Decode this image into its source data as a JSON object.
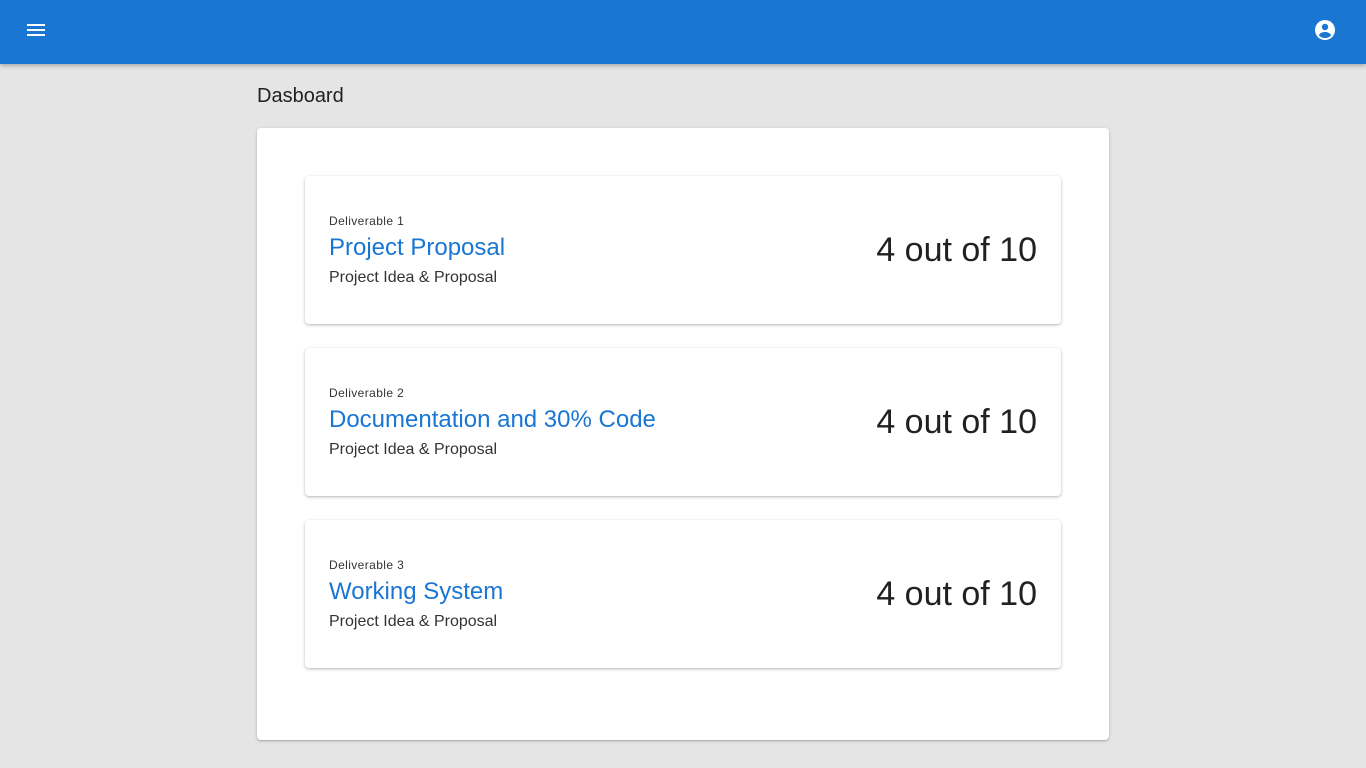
{
  "header": {
    "menu_icon": "menu-icon",
    "account_icon": "account-circle-icon",
    "color": "#1976d2"
  },
  "page": {
    "title": "Dasboard"
  },
  "deliverables": [
    {
      "overline": "Deliverable 1",
      "title": "Project Proposal",
      "subtitle": "Project Idea & Proposal",
      "score": "4 out of 10"
    },
    {
      "overline": "Deliverable 2",
      "title": "Documentation and 30% Code",
      "subtitle": "Project Idea & Proposal",
      "score": "4 out of 10"
    },
    {
      "overline": "Deliverable 3",
      "title": "Working System",
      "subtitle": "Project Idea & Proposal",
      "score": "4 out of 10"
    }
  ]
}
